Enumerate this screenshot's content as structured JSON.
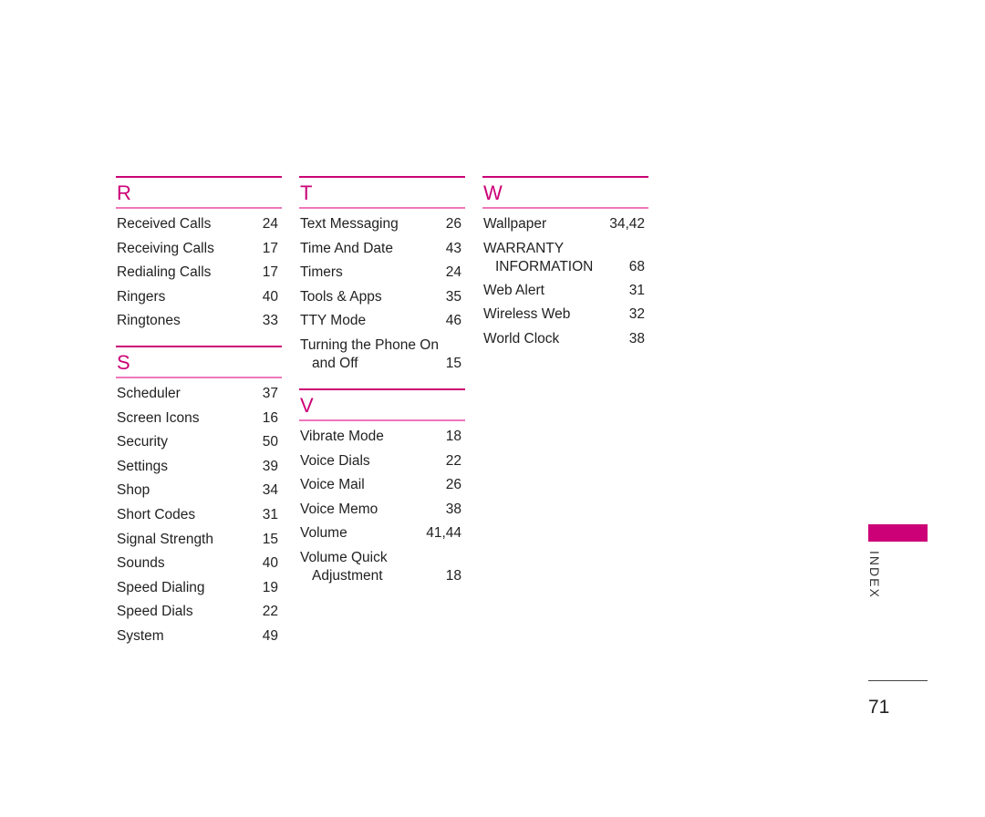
{
  "columns": [
    {
      "sections": [
        {
          "letter": "R",
          "entries": [
            {
              "label": "Received Calls",
              "page": "24"
            },
            {
              "label": "Receiving Calls",
              "page": "17"
            },
            {
              "label": "Redialing Calls",
              "page": "17"
            },
            {
              "label": "Ringers",
              "page": "40"
            },
            {
              "label": "Ringtones",
              "page": "33"
            }
          ]
        },
        {
          "letter": "S",
          "entries": [
            {
              "label": "Scheduler",
              "page": "37"
            },
            {
              "label": "Screen Icons",
              "page": "16"
            },
            {
              "label": "Security",
              "page": "50"
            },
            {
              "label": "Settings",
              "page": "39"
            },
            {
              "label": "Shop",
              "page": "34"
            },
            {
              "label": "Short Codes",
              "page": "31"
            },
            {
              "label": "Signal Strength",
              "page": "15"
            },
            {
              "label": "Sounds",
              "page": "40"
            },
            {
              "label": "Speed Dialing",
              "page": "19"
            },
            {
              "label": "Speed Dials",
              "page": "22"
            },
            {
              "label": "System",
              "page": "49"
            }
          ]
        }
      ]
    },
    {
      "sections": [
        {
          "letter": "T",
          "entries": [
            {
              "label": "Text Messaging",
              "page": "26"
            },
            {
              "label": "Time And Date",
              "page": "43"
            },
            {
              "label": "Timers",
              "page": "24"
            },
            {
              "label": "Tools & Apps",
              "page": "35"
            },
            {
              "label": "TTY Mode",
              "page": "46"
            },
            {
              "label": "Turning the Phone On",
              "label2": "and Off",
              "page": "15"
            }
          ]
        },
        {
          "letter": "V",
          "entries": [
            {
              "label": "Vibrate Mode",
              "page": "18"
            },
            {
              "label": "Voice Dials",
              "page": "22"
            },
            {
              "label": "Voice Mail",
              "page": "26"
            },
            {
              "label": "Voice Memo",
              "page": "38"
            },
            {
              "label": "Volume",
              "page": "41,44"
            },
            {
              "label": "Volume Quick",
              "label2": "Adjustment",
              "page": "18"
            }
          ]
        }
      ]
    },
    {
      "sections": [
        {
          "letter": "W",
          "entries": [
            {
              "label": "Wallpaper",
              "page": "34,42"
            },
            {
              "label": "WARRANTY",
              "label2": "INFORMATION",
              "page": "68"
            },
            {
              "label": "Web Alert",
              "page": "31"
            },
            {
              "label": "Wireless Web",
              "page": "32"
            },
            {
              "label": "World Clock",
              "page": "38"
            }
          ]
        }
      ]
    }
  ],
  "side_tab": {
    "label": "INDEX",
    "color": "#CC0077"
  },
  "page_number": "71",
  "accent_color": "#CC0077"
}
